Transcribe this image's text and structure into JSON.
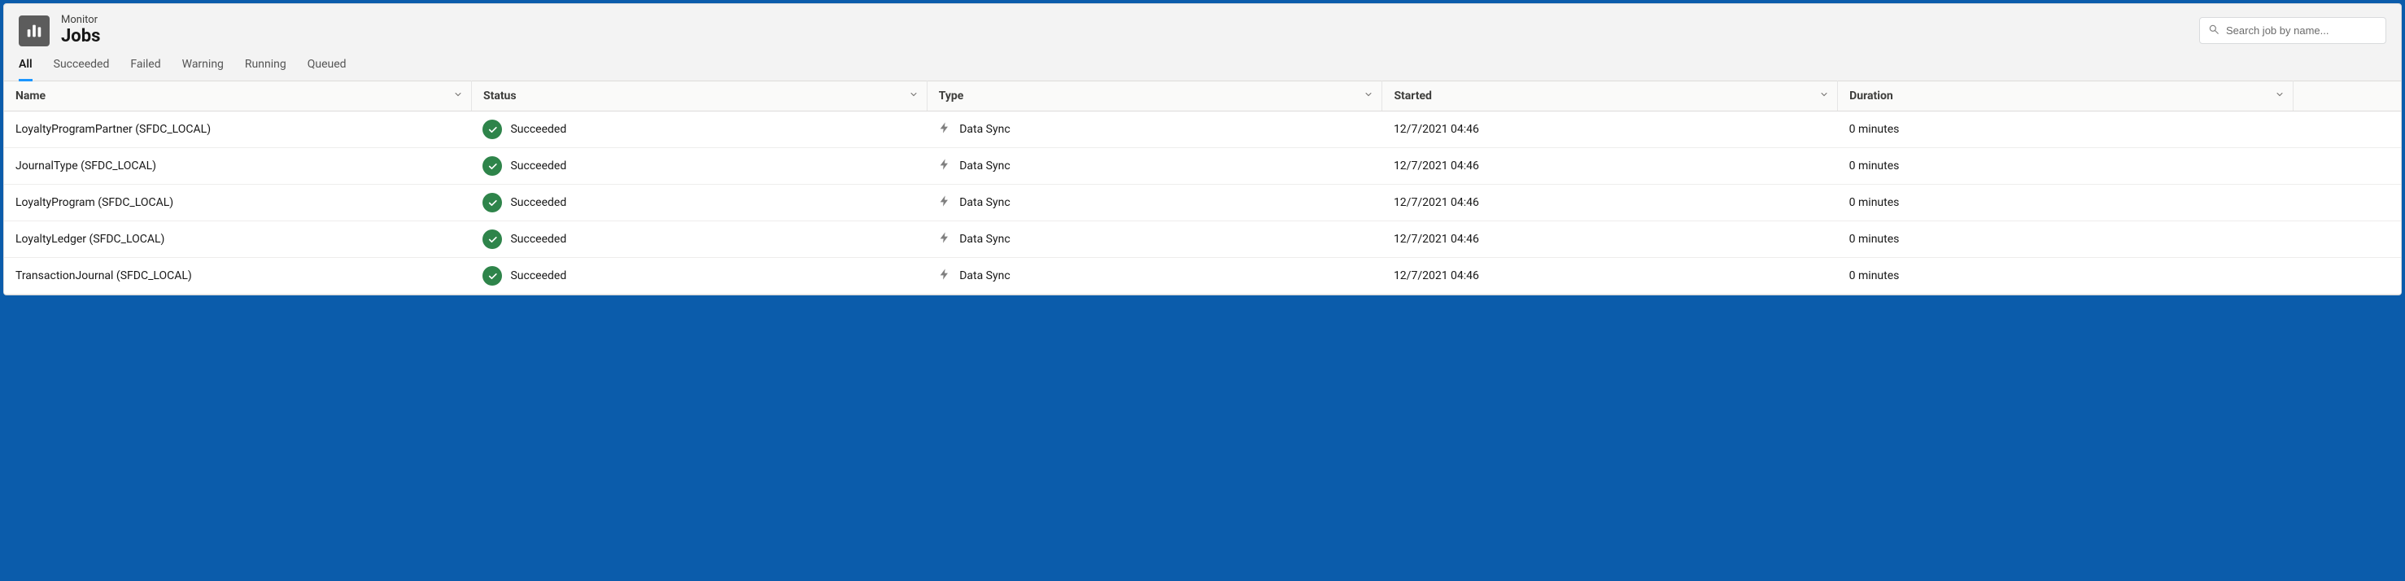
{
  "header": {
    "eyebrow": "Monitor",
    "title": "Jobs"
  },
  "search": {
    "placeholder": "Search job by name..."
  },
  "tabs": [
    {
      "label": "All",
      "active": true
    },
    {
      "label": "Succeeded",
      "active": false
    },
    {
      "label": "Failed",
      "active": false
    },
    {
      "label": "Warning",
      "active": false
    },
    {
      "label": "Running",
      "active": false
    },
    {
      "label": "Queued",
      "active": false
    }
  ],
  "columns": {
    "name": "Name",
    "status": "Status",
    "type": "Type",
    "started": "Started",
    "duration": "Duration"
  },
  "rows": [
    {
      "name": "LoyaltyProgramPartner (SFDC_LOCAL)",
      "status": "Succeeded",
      "type": "Data Sync",
      "started": "12/7/2021 04:46",
      "duration": "0 minutes"
    },
    {
      "name": "JournalType (SFDC_LOCAL)",
      "status": "Succeeded",
      "type": "Data Sync",
      "started": "12/7/2021 04:46",
      "duration": "0 minutes"
    },
    {
      "name": "LoyaltyProgram (SFDC_LOCAL)",
      "status": "Succeeded",
      "type": "Data Sync",
      "started": "12/7/2021 04:46",
      "duration": "0 minutes"
    },
    {
      "name": "LoyaltyLedger (SFDC_LOCAL)",
      "status": "Succeeded",
      "type": "Data Sync",
      "started": "12/7/2021 04:46",
      "duration": "0 minutes"
    },
    {
      "name": "TransactionJournal (SFDC_LOCAL)",
      "status": "Succeeded",
      "type": "Data Sync",
      "started": "12/7/2021 04:46",
      "duration": "0 minutes"
    }
  ]
}
